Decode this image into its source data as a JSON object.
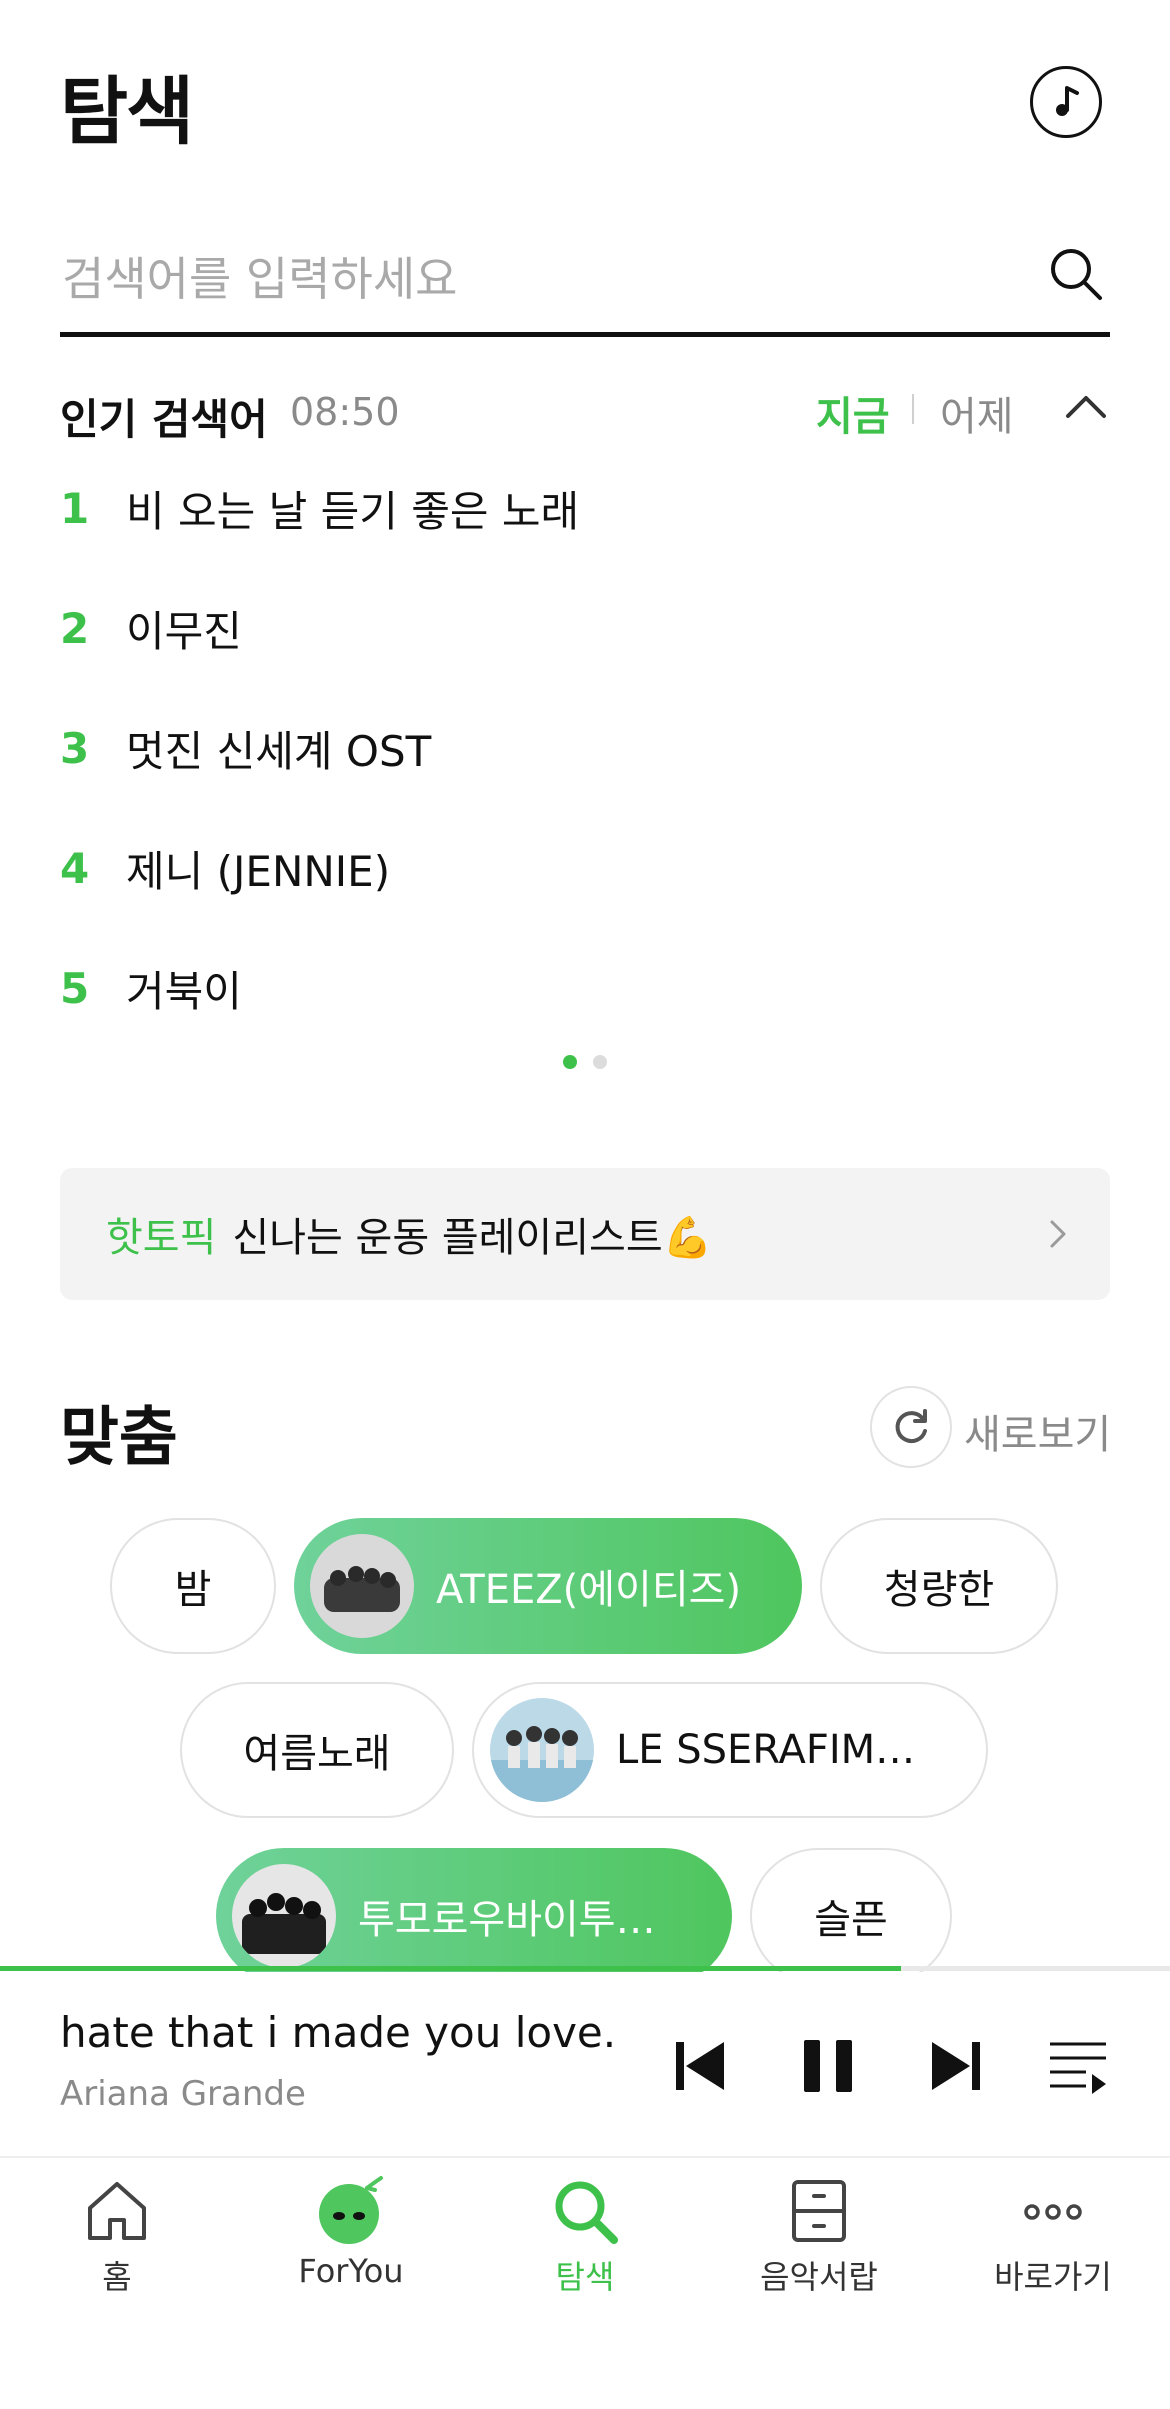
{
  "header": {
    "title": "탐색",
    "music_icon": "music-note-icon"
  },
  "search": {
    "placeholder": "검색어를 입력하세요"
  },
  "popular": {
    "title": "인기 검색어",
    "time": "08:50",
    "tab_now": "지금",
    "tab_yesterday": "어제",
    "items": [
      {
        "rank": "1",
        "text": "비 오는 날 듣기 좋은 노래"
      },
      {
        "rank": "2",
        "text": "이무진"
      },
      {
        "rank": "3",
        "text": "멋진 신세계 OST"
      },
      {
        "rank": "4",
        "text": "제니 (JENNIE)"
      },
      {
        "rank": "5",
        "text": "거북이"
      }
    ],
    "page_indicator": {
      "current": 1,
      "total": 2
    }
  },
  "hot_topic": {
    "label": "핫토픽",
    "text": "신나는 운동 플레이리스트💪"
  },
  "custom": {
    "title": "맞춤",
    "refresh_label": "새로보기",
    "chips": [
      {
        "label": "밤"
      },
      {
        "label": "ATEEZ(에이티즈)"
      },
      {
        "label": "청량한"
      },
      {
        "label": "여름노래"
      },
      {
        "label": "LE SSERAFIM…"
      },
      {
        "label": "투모로우바이투…"
      },
      {
        "label": "슬픈"
      }
    ]
  },
  "player": {
    "title": "hate that i made you love...",
    "artist": "Ariana Grande",
    "progress": 0.77
  },
  "nav": [
    {
      "label": "홈"
    },
    {
      "label": "ForYou"
    },
    {
      "label": "탐색"
    },
    {
      "label": "음악서랍"
    },
    {
      "label": "바로가기"
    }
  ],
  "colors": {
    "accent": "#3ec14b"
  }
}
